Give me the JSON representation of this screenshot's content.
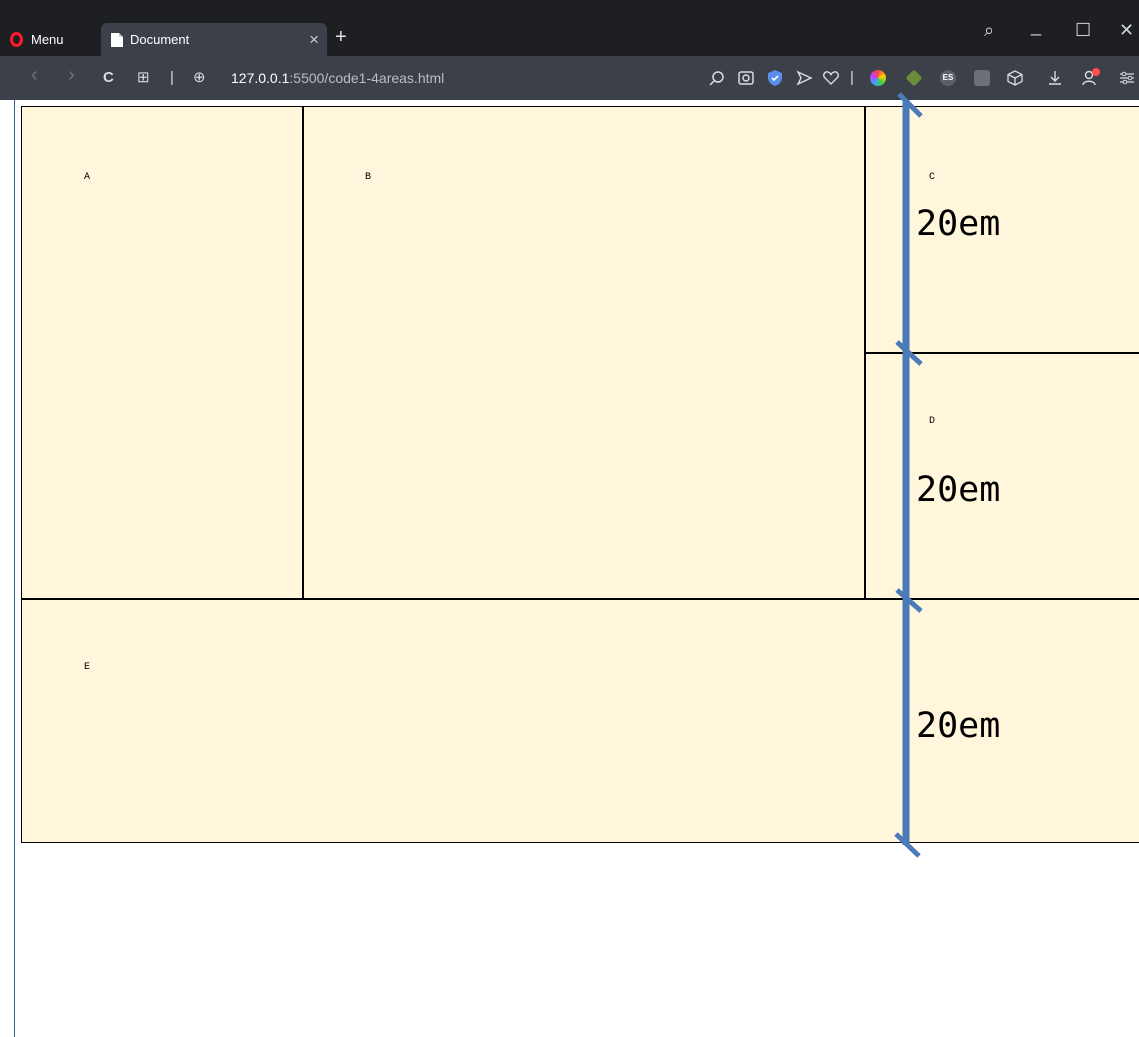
{
  "browser": {
    "menu_label": "Menu",
    "tab": {
      "title": "Document",
      "close": "×"
    },
    "new_tab": "+",
    "window_controls": {
      "search": "⌕",
      "minimize": "_",
      "maximize": "☐",
      "close": "✕"
    },
    "nav": {
      "back": "‹",
      "forward": "›",
      "reload": "C",
      "tabs_grid": "⊞",
      "separator": "|",
      "site_icon": "⊕"
    },
    "url": {
      "host": "127.0.0.1",
      "rest": ":5500/code1-4areas.html"
    },
    "toolbar_icons": [
      "search-page-icon",
      "snapshot-icon",
      "vpn-shield-icon",
      "send-icon",
      "heart-icon",
      "color-picker-icon",
      "cube-extension-icon",
      "es-extension-icon",
      "css-extension-icon",
      "box-icon",
      "download-icon",
      "profile-icon",
      "easy-setup-icon"
    ]
  },
  "page": {
    "areas": {
      "a": "A",
      "b": "B",
      "c": "C",
      "d": "D",
      "e": "E"
    },
    "colors": {
      "cell_background": "#fff6dc",
      "border": "#000000",
      "measure_line": "#4a7ab8"
    }
  },
  "annotations": {
    "row_heights": [
      "20em",
      "20em",
      "20em"
    ]
  }
}
